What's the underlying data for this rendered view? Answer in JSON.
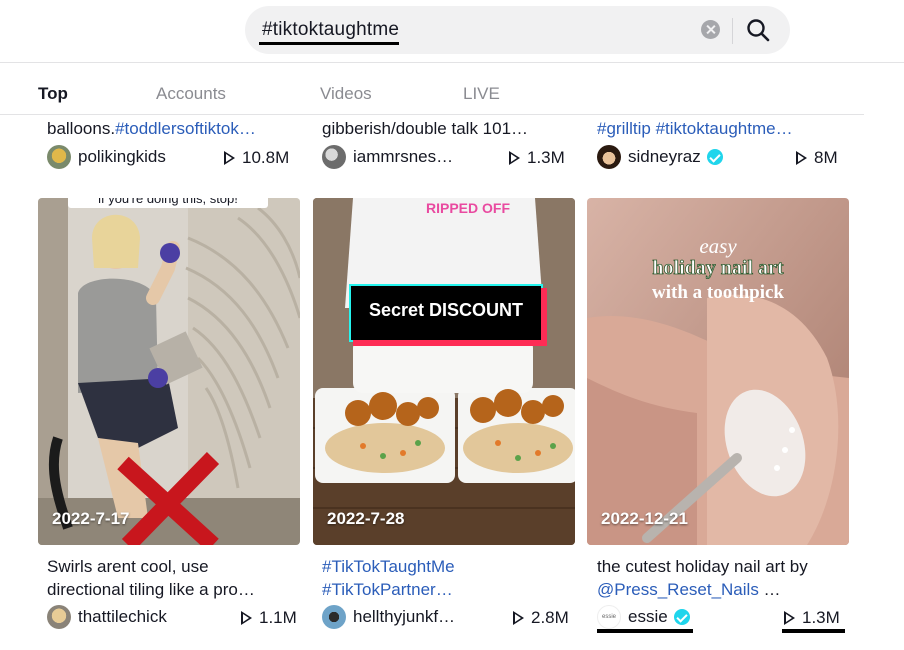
{
  "search": {
    "query": "#tiktoktaughtme",
    "clear_icon": "clear-icon",
    "search_icon": "search-icon"
  },
  "tabs": [
    {
      "label": "Top",
      "active": true
    },
    {
      "label": "Accounts",
      "active": false
    },
    {
      "label": "Videos",
      "active": false
    },
    {
      "label": "LIVE",
      "active": false
    }
  ],
  "top_row": [
    {
      "caption_plain": "balloons.",
      "caption_tag": "#toddlersoftiktok…",
      "author": "polikingkids",
      "verified": false,
      "views": "10.8M"
    },
    {
      "caption_plain": "gibberish/double talk 101…",
      "caption_tag": "",
      "author": "iammrsnes…",
      "verified": false,
      "views": "1.3M"
    },
    {
      "caption_plain": "",
      "caption_tag": "#grilltip #tiktoktaughtme…",
      "author": "sidneyraz",
      "verified": true,
      "views": "8M"
    }
  ],
  "videos": [
    {
      "date": "2022-7-17",
      "overlay_text": "if you're doing this, stop!",
      "caption_line1": "Swirls arent cool, use",
      "caption_line2": "directional tiling like a pro…",
      "author": "thattilechick",
      "verified": false,
      "views": "1.1M"
    },
    {
      "date": "2022-7-28",
      "overlay_text": "Secret DISCOUNT",
      "shirt_text": "RIPPED OFF",
      "caption_line1": "#TikTokTaughtMe",
      "caption_line2": "#TikTokPartner…",
      "author": "hellthyjunkf…",
      "verified": false,
      "views": "2.8M"
    },
    {
      "date": "2022-12-21",
      "overlay_line1": "easy",
      "overlay_line2": "holiday nail art",
      "overlay_line3": "with a toothpick",
      "caption_line1": "the cutest holiday nail art by",
      "caption_mention": "@Press_Reset_Nails",
      "caption_suffix": " …",
      "avatar_text": "essie",
      "author": "essie",
      "verified": true,
      "views": "1.3M"
    }
  ],
  "colors": {
    "tag_blue": "#2b5db9",
    "verified": "#20d5ec",
    "secret_red": "#fe2c55",
    "secret_cyan": "#25f4ee",
    "x_red": "#c8161d"
  }
}
